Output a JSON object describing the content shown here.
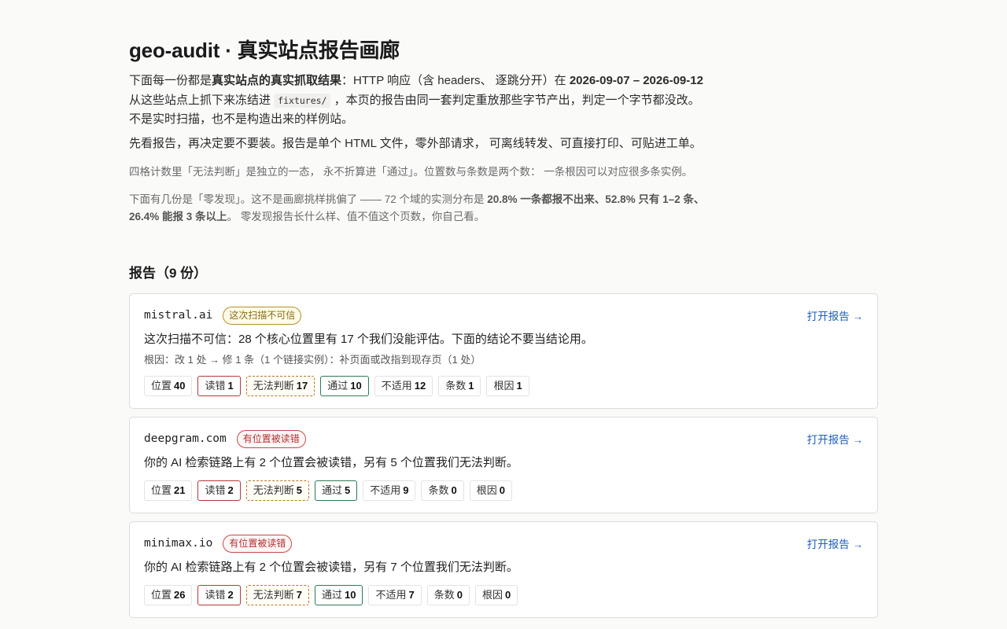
{
  "title": "geo-audit · 真实站点报告画廊",
  "intro": {
    "p1_a": "下面每一份都是",
    "p1_b": "真实站点的真实抓取结果",
    "p1_c": "：HTTP 响应（含 headers、 逐跳分开）在 ",
    "p1_dates": "2026-09-07 – 2026-09-12",
    "p1_d": " 从这些站点上抓下来冻结进 ",
    "p1_code": "fixtures/",
    "p1_e": " ，本页的报告由同一套判定重放那些字节产出，判定一个字节都没改。 不是实时扫描，也不是构造出来的样例站。",
    "p2": "先看报告，再决定要不要装。报告是单个 HTML 文件，零外部请求， 可离线转发、可直接打印、可贴进工单。"
  },
  "notes": {
    "n1": "四格计数里「无法判断」是独立的一态， 永不折算进「通过」。位置数与条数是两个数： 一条根因可以对应很多条实例。",
    "n2_a": "下面有几份是「零发现」。这不是画廊挑样挑偏了 —— 72 个域的实测分布是 ",
    "n2_b": "20.8% 一条都报不出来、52.8% 只有 1–2 条、26.4% 能报 3 条以上",
    "n2_c": "。 零发现报告长什么样、值不值这个页数，你自己看。"
  },
  "section_title": "报告（9 份）",
  "open_label": "打开报告 →",
  "chip_labels": {
    "positions": "位置",
    "misread": "读错",
    "unknown": "无法判断",
    "pass": "通过",
    "na": "不适用",
    "count": "条数",
    "root": "根因"
  },
  "reports": [
    {
      "domain": "mistral.ai",
      "badge": "这次扫描不可信",
      "summary": "这次扫描不可信：28 个核心位置里有 17 个我们没能评估。下面的结论不要当结论用。",
      "cause": "根因：改 1 处 → 修 1 条（1 个链接实例）：补页面或改指到现存页（1 处）",
      "positions": "40",
      "misread": "1",
      "unknown": "17",
      "pass": "10",
      "na": "12",
      "count": "1",
      "root": "1"
    },
    {
      "domain": "deepgram.com",
      "badge": "有位置被读错",
      "summary": "你的 AI 检索链路上有 2 个位置会被读错，另有 5 个位置我们无法判断。",
      "positions": "21",
      "misread": "2",
      "unknown": "5",
      "pass": "5",
      "na": "9",
      "count": "0",
      "root": "0"
    },
    {
      "domain": "minimax.io",
      "badge": "有位置被读错",
      "summary": "你的 AI 检索链路上有 2 个位置会被读错，另有 7 个位置我们无法判断。",
      "positions": "26",
      "misread": "2",
      "unknown": "7",
      "pass": "10",
      "na": "7",
      "count": "0",
      "root": "0"
    }
  ],
  "colors": {
    "accent_link": "#1f5fbf",
    "misread": "#b33a3a",
    "unknown": "#b07a2a",
    "pass": "#2f7a55"
  }
}
